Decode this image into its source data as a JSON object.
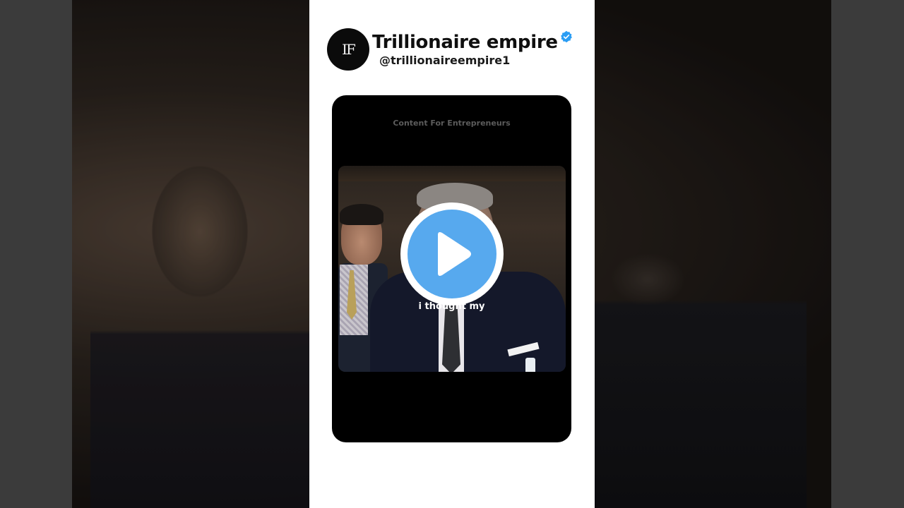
{
  "channel": {
    "avatar_text": "IF",
    "name": "Trillionaire empire",
    "handle": "@trillionaireempire1",
    "verified_icon": "verified-badge-icon"
  },
  "video": {
    "top_text": "Content For Entrepreneurs",
    "subtitle": "i thought my",
    "play_icon": "play-icon"
  },
  "colors": {
    "panel_background": "#ffffff",
    "play_button": "#57a9ee",
    "verified": "#2a9df4"
  }
}
